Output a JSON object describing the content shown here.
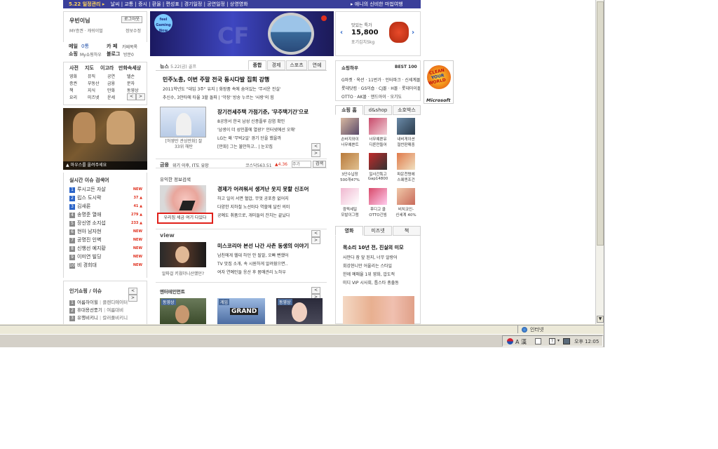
{
  "topnav": {
    "date_label": "5.22 일정관리 ▸",
    "items": [
      "날씨",
      "교통",
      "증시",
      "환율",
      "편성표",
      "경기일정",
      "공연일정",
      "상영영화"
    ],
    "promo": "▸ 애니의 신비한 마법여행"
  },
  "login_box": {
    "title": "우빈이님",
    "logout_button": "로그아웃",
    "links": "MY증권 · 캐쉬이멀",
    "info_edit": "정보수정",
    "mail_label": "메일",
    "mail_count": "0통",
    "cafe_label": "카 페",
    "cafe_link": "카페목록",
    "shopping_label": "쇼핑",
    "shopping_link": "My쇼핑하우",
    "blog_label": "블로그",
    "blog_link": "방문0"
  },
  "service_menu": {
    "headers": [
      "사전",
      "지도",
      "이고라",
      "만화속세상"
    ],
    "rows": [
      [
        "영화",
        "뮤직",
        "공연",
        "텔손"
      ],
      [
        "증권",
        "부동산",
        "금융",
        "문자"
      ],
      [
        "책",
        "지식",
        "만화",
        "동영상"
      ],
      [
        "요리",
        "미즈넷",
        "운세",
        ""
      ]
    ]
  },
  "video_promo": {
    "caption": "마우스를 올려주세요"
  },
  "realtime": {
    "title": "실시간 이슈 검색어",
    "items": [
      {
        "rank": "1",
        "text": "루시고든 자살",
        "badge": "NEW"
      },
      {
        "rank": "2",
        "text": "립스 도시락",
        "badge": "37 ▲"
      },
      {
        "rank": "3",
        "text": "김새론",
        "badge": "41 ▲"
      },
      {
        "rank": "4",
        "text": "송명준 열애",
        "badge": "279 ▲"
      },
      {
        "rank": "5",
        "text": "장신영 소지섭",
        "badge": "233 ▲"
      },
      {
        "rank": "6",
        "text": "현아 남자현",
        "badge": "NEW"
      },
      {
        "rank": "7",
        "text": "공명진 인벽",
        "badge": "NEW"
      },
      {
        "rank": "8",
        "text": "신행선 예지황",
        "badge": "NEW"
      },
      {
        "rank": "9",
        "text": "이미연 빌딩",
        "badge": "NEW"
      },
      {
        "rank": "10",
        "text": "비 경희대",
        "badge": "NEW"
      }
    ]
  },
  "popular_shopping": {
    "title": "인기쇼핑 / 이슈",
    "items": [
      {
        "rank": "1",
        "text": "여름하이힐",
        "extra": "클렌디에이터"
      },
      {
        "rank": "2",
        "text": "휴대용선풍기",
        "extra": "여름대비"
      },
      {
        "rank": "3",
        "text": "유행비키니",
        "extra": "칼러풀비키니"
      }
    ]
  },
  "banner": {
    "badge": "feel Gaming Now",
    "ad_text": "CF"
  },
  "news": {
    "section_label": "뉴스",
    "date": "5.22(금)",
    "extra": "골프",
    "tabs": [
      "종합",
      "경제",
      "스포츠",
      "연예"
    ],
    "headline": "민주노총, 이번 주말 전국 동시다발 집회 강행",
    "lines": [
      "2011학년도 \"대입 3주\" 유지 | 화장품 속에 숨어있는 '무서운 진실'",
      "추신수, 3안타에 타율 3할 돌파 | '악장' 방송 누르는 '사랑'의 힘"
    ]
  },
  "article2": {
    "caption": "[허영만 관상만화] 잘 33위 해탄",
    "headline": "장기전세주택 가점기준, '무주택기간'으로",
    "lines": [
      "8공항서 한국 남성 신종플루 감염 확인",
      "'남생이 더 성인폴에 열광?' 인터넷에선 오해'",
      "LG는 왜 '무박2일' 경기 단을 했을까",
      "[만화] 그는 불안하고.. | 눈꼬집"
    ]
  },
  "finance": {
    "label": "금융",
    "text": "위기 이후, IT도 유망",
    "index_label": "코스닥563.51",
    "index_change": "▲4.36",
    "stock_placeholder": "주가",
    "search_button": "검색"
  },
  "info_section": {
    "title": "유익한 정보검색",
    "highlight_caption": "우리집 세금 여기 다있다",
    "headline": "경제가 어려워서 생겨난 웃지 못할 신조어",
    "lines": [
      "하고 일이 서면 혈압, 무엇 공포증 없어지",
      "다양한 지하철 노선마다 역할에 달린 의미",
      "공예도 취품으로, 개미들의 잔치는 끝났다"
    ]
  },
  "view_section": {
    "title": "view",
    "caption": "알파걸 키웠더니산했던?",
    "headline": "미스코리아 본선 나간 사촌 동생의 이야기",
    "lines": [
      "남친에게 헬대 하던 안 될말, 오빠 뻔했어",
      "TV 맛집 소개, 속 시원하게 알려줬으면..",
      "여자 연예인들 응산 후 몸매관리 노하우"
    ]
  },
  "entertainment": {
    "title": "엔터테인먼트",
    "thumbs": [
      "동영상",
      "게임",
      "동영상"
    ],
    "center_label": "GRAND"
  },
  "right_promo": {
    "label": "맛있는 특가",
    "price": "15,800",
    "desc": "포기김치5kg"
  },
  "shopping_how": {
    "title": "쇼핑하우",
    "best": "BEST 100",
    "lines": [
      "G마켓 · 옥션 · 11번가 · 인터파크 · 신세계몰",
      "롯데닷컴 · GS이숍 · CJ몰 · H몰 · 롯데아이몰",
      "OTTO · AK몰 · 앤드아이 · 오기도"
    ]
  },
  "shop_tabs": [
    "쇼핑 홈",
    "d&shop",
    "소호박스"
  ],
  "shop_items": [
    {
      "text1": "손바지와이",
      "text2": "너무예쁜트"
    },
    {
      "text1": "너무예쁜유",
      "text2": "디른만들어"
    },
    {
      "text1": "내비게이션",
      "text2": "절찬판매중"
    },
    {
      "text1": "3단수납장",
      "text2": "500개47%"
    },
    {
      "text1": "일사간특고",
      "text2": "Gap14800"
    },
    {
      "text1": "파운천령에",
      "text2": "스웨엔조건"
    },
    {
      "text1": "깜찍세일",
      "text2": "모발이그럼"
    },
    {
      "text1": "후디고 클",
      "text2": "OTTO긴빔"
    },
    {
      "text1": "비치코인-",
      "text2": "신세계 40%"
    }
  ],
  "side_ad": {
    "brand_line1": "CLEAN",
    "brand_line2": "YOUR",
    "brand_line3": "WORLD",
    "company": "Microsoft"
  },
  "movie_tabs": [
    "영화",
    "미즈넷",
    "책"
  ],
  "movie": {
    "headline": "목소리 10년 전, 진실의 미모",
    "lines": [
      "사만다 잠 앞 된지, 너무 알랑어",
      "회강현니만 어울리는 스타일",
      "한께 예매율 1위 영화, 압도적",
      "미디 VIP 시사회, 톱스타 총출동"
    ]
  },
  "status": {
    "zone": "인터넷"
  },
  "tray": {
    "clock": "오후 12:05",
    "ime": "A 漢"
  }
}
